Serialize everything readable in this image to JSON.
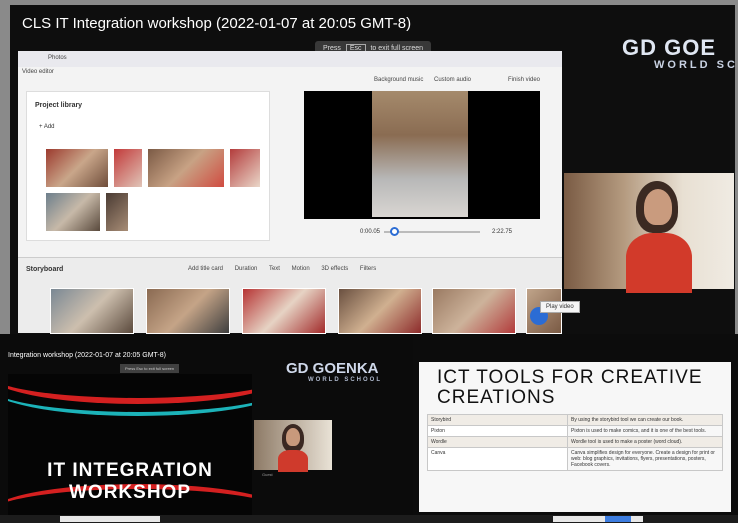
{
  "top_panel": {
    "recording_title": "CLS IT Integration workshop (2022-01-07 at 20:05 GMT-8)",
    "esc_hint": {
      "prefix": "Press",
      "key": "Esc",
      "suffix": "to exit full screen"
    },
    "editor": {
      "app_label": "Photos",
      "tab_label": "Video editor",
      "toolbar": {
        "background_music": "Background music",
        "custom_audio": "Custom audio",
        "finish_video": "Finish video"
      },
      "library_title": "Project library",
      "add_label": "+ Add",
      "player_time_current": "0:00.05",
      "player_time_total": "2:22.75",
      "storyboard_title": "Storyboard",
      "storyboard_tools": [
        "Add title card",
        "Duration",
        "Text",
        "Motion",
        "3D effects",
        "Filters"
      ],
      "tooltip": "Play video"
    },
    "logo": {
      "line1": "GD GOE",
      "line2": "WORLD SCHO"
    }
  },
  "bottom_left": {
    "recording_title": "Integration workshop (2022-01-07 at 20:05 GMT-8)",
    "esc_hint": "Press Esc to exit full screen",
    "slide_heading_line1": "IT INTEGRATION",
    "slide_heading_line2": "WORKSHOP",
    "logo": {
      "line1": "GD GOENKA",
      "line2": "WORLD SCHOOL"
    },
    "camera_label": "Guest"
  },
  "bottom_right": {
    "slide_heading_line1": "ICT TOOLS FOR CREATIVE",
    "slide_heading_line2": "CREATIONS",
    "tools_table": [
      {
        "name": "Storybird",
        "desc": "By using the storybird tool we can create our book."
      },
      {
        "name": "Pixton",
        "desc": "Pixton is used to make comics, and it is one of the best tools."
      },
      {
        "name": "Wordle",
        "desc": "Wordle tool is used to make a poster (word cloud)."
      },
      {
        "name": "Canva",
        "desc": "Canva simplifies design for everyone. Create a design for print or web: blog graphics, invitations, flyers, presentations, posters, Facebook covers."
      }
    ]
  },
  "colors": {
    "accent_blue": "#2b6cd4",
    "slide_red": "#d42020",
    "slide_teal": "#1cb3b9"
  }
}
